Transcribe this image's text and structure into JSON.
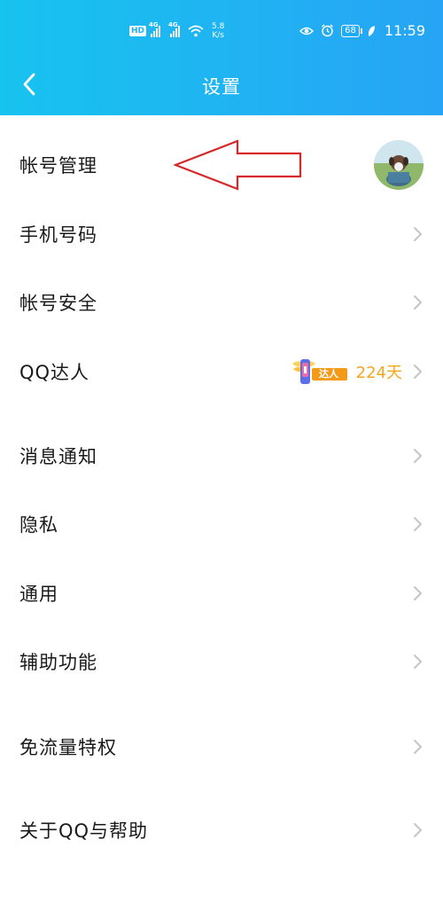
{
  "status_bar": {
    "network_badge": "HD",
    "network_type_1": "4G",
    "network_type_2": "4G",
    "speed_value": "5.8",
    "speed_unit": "K/s",
    "battery_level": "68",
    "time": "11:59"
  },
  "header": {
    "title": "设置",
    "back_icon": "chevron-left-icon",
    "background_color": "#1fb4f2"
  },
  "settings": {
    "items": [
      {
        "label": "帐号管理"
      },
      {
        "label": "手机号码"
      },
      {
        "label": "帐号安全"
      },
      {
        "label": "QQ达人",
        "badge_text": "达人",
        "days": "224天"
      },
      {
        "label": "消息通知"
      },
      {
        "label": "隐私"
      },
      {
        "label": "通用"
      },
      {
        "label": "辅助功能"
      },
      {
        "label": "免流量特权"
      },
      {
        "label": "关于QQ与帮助"
      }
    ]
  },
  "colors": {
    "annotation_arrow": "#d62828",
    "daren_days": "#f2a81d",
    "chevron": "#c4c4c4"
  }
}
